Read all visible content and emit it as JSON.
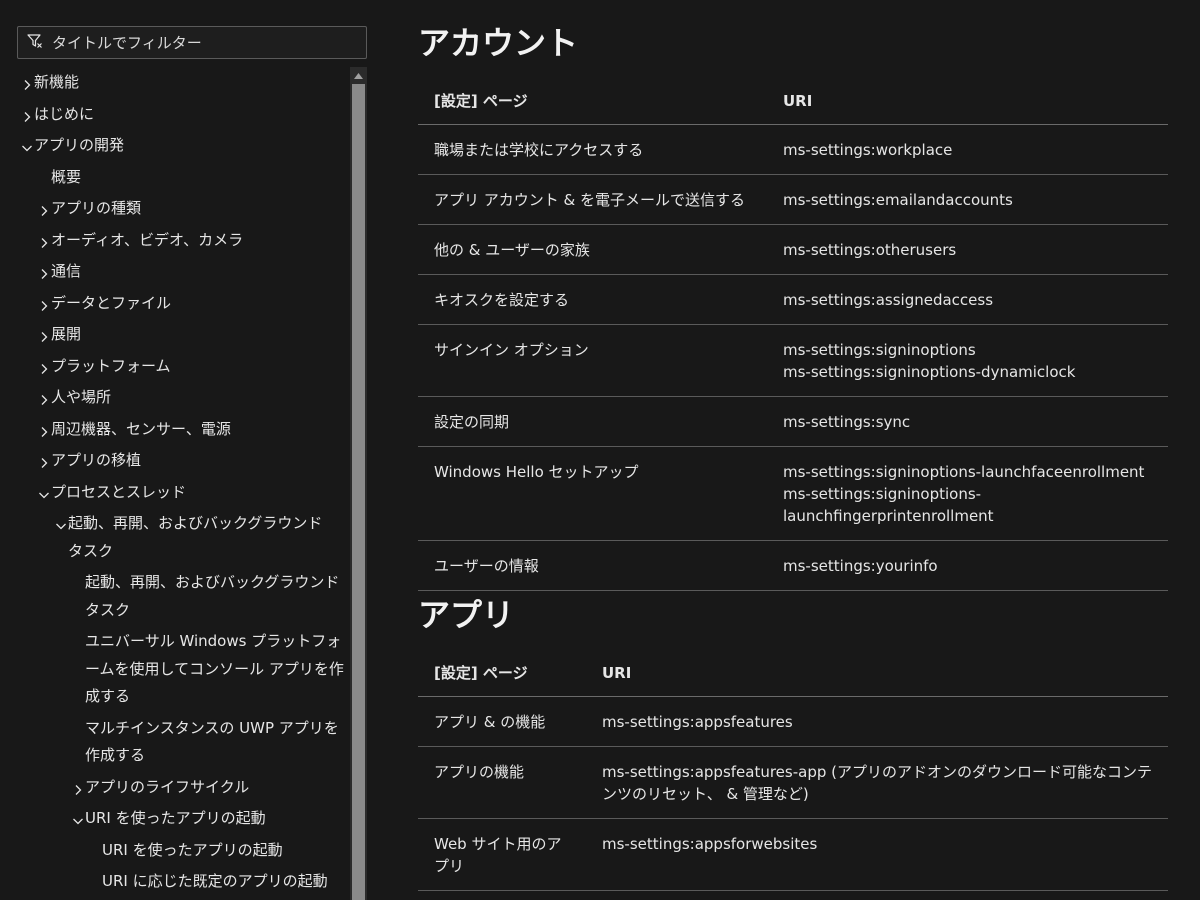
{
  "sidebar": {
    "filter_placeholder": "タイトルでフィルター",
    "items": [
      {
        "label": "新機能",
        "indent": 0,
        "chevron": "right"
      },
      {
        "label": "はじめに",
        "indent": 0,
        "chevron": "right"
      },
      {
        "label": "アプリの開発",
        "indent": 0,
        "chevron": "down"
      },
      {
        "label": "概要",
        "indent": 1,
        "chevron": "none"
      },
      {
        "label": "アプリの種類",
        "indent": 1,
        "chevron": "right"
      },
      {
        "label": "オーディオ、ビデオ、カメラ",
        "indent": 1,
        "chevron": "right"
      },
      {
        "label": "通信",
        "indent": 1,
        "chevron": "right"
      },
      {
        "label": "データとファイル",
        "indent": 1,
        "chevron": "right"
      },
      {
        "label": "展開",
        "indent": 1,
        "chevron": "right"
      },
      {
        "label": "プラットフォーム",
        "indent": 1,
        "chevron": "right"
      },
      {
        "label": "人や場所",
        "indent": 1,
        "chevron": "right"
      },
      {
        "label": "周辺機器、センサー、電源",
        "indent": 1,
        "chevron": "right"
      },
      {
        "label": "アプリの移植",
        "indent": 1,
        "chevron": "right"
      },
      {
        "label": "プロセスとスレッド",
        "indent": 1,
        "chevron": "down"
      },
      {
        "label": "起動、再開、およびバックグラウンド タスク",
        "indent": 2,
        "chevron": "down"
      },
      {
        "label": "起動、再開、およびバックグラウンド タスク",
        "indent": 3,
        "chevron": "none"
      },
      {
        "label": "ユニバーサル Windows プラットフォームを使用してコンソール アプリを作成する",
        "indent": 3,
        "chevron": "none"
      },
      {
        "label": "マルチインスタンスの UWP アプリを作成する",
        "indent": 3,
        "chevron": "none"
      },
      {
        "label": "アプリのライフサイクル",
        "indent": 3,
        "chevron": "right"
      },
      {
        "label": "URI を使ったアプリの起動",
        "indent": 3,
        "chevron": "down"
      },
      {
        "label": "URI を使ったアプリの起動",
        "indent": 4,
        "chevron": "none"
      },
      {
        "label": "URI に応じた既定のアプリの起動",
        "indent": 4,
        "chevron": "none"
      }
    ]
  },
  "sections": [
    {
      "title": "アカウント",
      "header": [
        "[設定] ページ",
        "URI"
      ],
      "rows": [
        {
          "page": "職場または学校にアクセスする",
          "uris": [
            "ms-settings:workplace"
          ]
        },
        {
          "page": "アプリ アカウント & を電子メールで送信する",
          "uris": [
            "ms-settings:emailandaccounts"
          ]
        },
        {
          "page": "他の & ユーザーの家族",
          "uris": [
            "ms-settings:otherusers"
          ]
        },
        {
          "page": "キオスクを設定する",
          "uris": [
            "ms-settings:assignedaccess"
          ]
        },
        {
          "page": "サインイン オプション",
          "uris": [
            "ms-settings:signinoptions",
            "ms-settings:signinoptions-dynamiclock"
          ]
        },
        {
          "page": "設定の同期",
          "uris": [
            "ms-settings:sync"
          ]
        },
        {
          "page": "Windows Hello セットアップ",
          "uris": [
            "ms-settings:signinoptions-launchfaceenrollment",
            "ms-settings:signinoptions-launchfingerprintenrollment"
          ]
        },
        {
          "page": "ユーザーの情報",
          "uris": [
            "ms-settings:yourinfo"
          ]
        }
      ]
    },
    {
      "title": "アプリ",
      "header": [
        "[設定] ページ",
        "URI"
      ],
      "rows": [
        {
          "page": "アプリ & の機能",
          "uris": [
            "ms-settings:appsfeatures"
          ]
        },
        {
          "page": "アプリの機能",
          "uris": [
            "ms-settings:appsfeatures-app (アプリのアドオンのダウンロード可能なコンテンツのリセット、 & 管理など)"
          ]
        },
        {
          "page": "Web サイト用のアプリ",
          "uris": [
            "ms-settings:appsforwebsites"
          ]
        }
      ]
    }
  ],
  "icons": {
    "filter": "filter-icon",
    "chevron_right": "chevron-right-icon",
    "chevron_down": "chevron-down-icon",
    "scroll_up": "scroll-up-arrow-icon"
  }
}
